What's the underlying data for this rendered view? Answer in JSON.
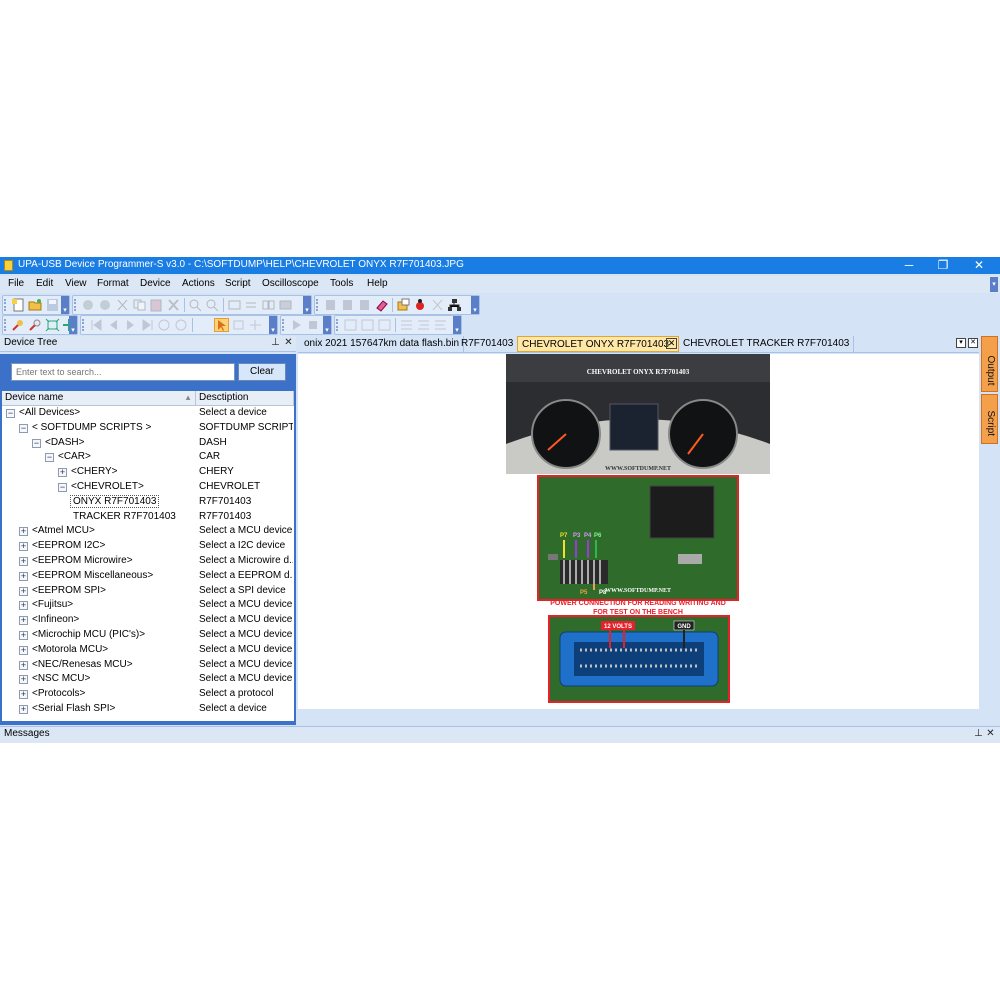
{
  "window": {
    "title": "UPA-USB Device Programmer-S v3.0 - C:\\SOFTDUMP\\HELP\\CHEVROLET ONYX R7F701403.JPG",
    "minimize": "─",
    "maximize": "❐",
    "close": "✕"
  },
  "menu": [
    "File",
    "Edit",
    "View",
    "Format",
    "Device",
    "Actions",
    "Script",
    "Oscilloscope",
    "Tools",
    "Help"
  ],
  "device_tree": {
    "panel_title": "Device Tree",
    "pin_glyph": "📌",
    "close_glyph": "✕",
    "search_placeholder": "Enter text to search...",
    "clear_label": "Clear",
    "columns": {
      "name": "Device name",
      "description": "Desctiption"
    },
    "rows": [
      {
        "name": "<All Devices>",
        "description": "Select a device",
        "exp": "⊟"
      },
      {
        "name": "< SOFTDUMP SCRIPTS >",
        "description": "SOFTDUMP SCRIPTS",
        "exp": "⊟"
      },
      {
        "name": "<DASH>",
        "description": "DASH",
        "exp": "⊟"
      },
      {
        "name": "<CAR>",
        "description": "CAR",
        "exp": "⊟"
      },
      {
        "name": "<CHERY>",
        "description": "CHERY",
        "exp": "⊞"
      },
      {
        "name": "<CHEVROLET>",
        "description": "CHEVROLET",
        "exp": "⊟"
      },
      {
        "name": "ONYX R7F701403",
        "description": "R7F701403",
        "exp": ""
      },
      {
        "name": "TRACKER R7F701403",
        "description": "R7F701403",
        "exp": ""
      },
      {
        "name": "<Atmel MCU>",
        "description": "Select a MCU device",
        "exp": "⊞"
      },
      {
        "name": "<EEPROM I2C>",
        "description": "Select a I2C device",
        "exp": "⊞"
      },
      {
        "name": "<EEPROM Microwire>",
        "description": "Select a Microwire d...",
        "exp": "⊞"
      },
      {
        "name": "<EEPROM Miscellaneous>",
        "description": "Select a EEPROM d...",
        "exp": "⊞"
      },
      {
        "name": "<EEPROM SPI>",
        "description": "Select a SPI device",
        "exp": "⊞"
      },
      {
        "name": "<Fujitsu>",
        "description": "Select a MCU device",
        "exp": "⊞"
      },
      {
        "name": "<Infineon>",
        "description": "Select a MCU device",
        "exp": "⊞"
      },
      {
        "name": "<Microchip MCU (PIC's)>",
        "description": "Select a MCU device",
        "exp": "⊞"
      },
      {
        "name": "<Motorola MCU>",
        "description": "Select a MCU device",
        "exp": "⊞"
      },
      {
        "name": "<NEC/Renesas MCU>",
        "description": "Select a MCU device",
        "exp": "⊞"
      },
      {
        "name": "<NSC MCU>",
        "description": "Select a MCU device",
        "exp": "⊞"
      },
      {
        "name": "<Protocols>",
        "description": "Select a protocol",
        "exp": "⊞"
      },
      {
        "name": "<Serial Flash SPI>",
        "description": "Select a device",
        "exp": "⊞"
      }
    ]
  },
  "doc_tabs": [
    {
      "label": "onix 2021 157647km data flash.bin",
      "active": false
    },
    {
      "label": "R7F701403",
      "active": false
    },
    {
      "label": "CHEVROLET ONYX R7F701403",
      "active": true
    },
    {
      "label": "CHEVROLET TRACKER R7F701403",
      "active": false
    }
  ],
  "tab_close_glyph": "✕",
  "tab_list_glyph": "▾",
  "image": {
    "cluster_title": "CHEVROLET ONYX R7F701403",
    "watermark": "WWW.SOFTDUMP.NET",
    "pins": [
      "P7",
      "P3",
      "P4",
      "P6",
      "P5",
      "P8"
    ],
    "power_caption_line1": "POWER CONNECTION FOR READING WRITING AND",
    "power_caption_line2": "FOR TEST ON THE BENCH",
    "volts_label": "12 VOLTS",
    "gnd_label": "GND",
    "colors": {
      "red": "#e8202a",
      "yellow": "#f4e028",
      "purple": "#9b3bd6",
      "green": "#2eb84a",
      "pcb": "#2f6b2b"
    }
  },
  "side_tabs": [
    "Output",
    "Script"
  ],
  "messages": {
    "title": "Messages"
  }
}
